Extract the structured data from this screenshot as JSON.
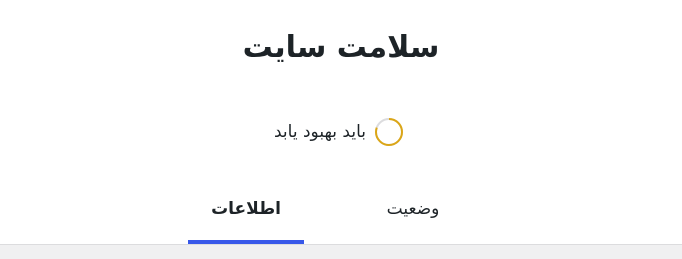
{
  "header": {
    "title": "سلامت سایت"
  },
  "rating": {
    "label": "باید بهبود یابد",
    "progress": 0.8,
    "status_color": "#dba617",
    "track_color": "#dcdcde"
  },
  "tabs": [
    {
      "label": "وضعیت",
      "active": false
    },
    {
      "label": "اطلاعات",
      "active": true
    }
  ],
  "colors": {
    "accent": "#3858e9",
    "text": "#1d2327",
    "background": "#ffffff",
    "content_background": "#f0f0f1"
  }
}
